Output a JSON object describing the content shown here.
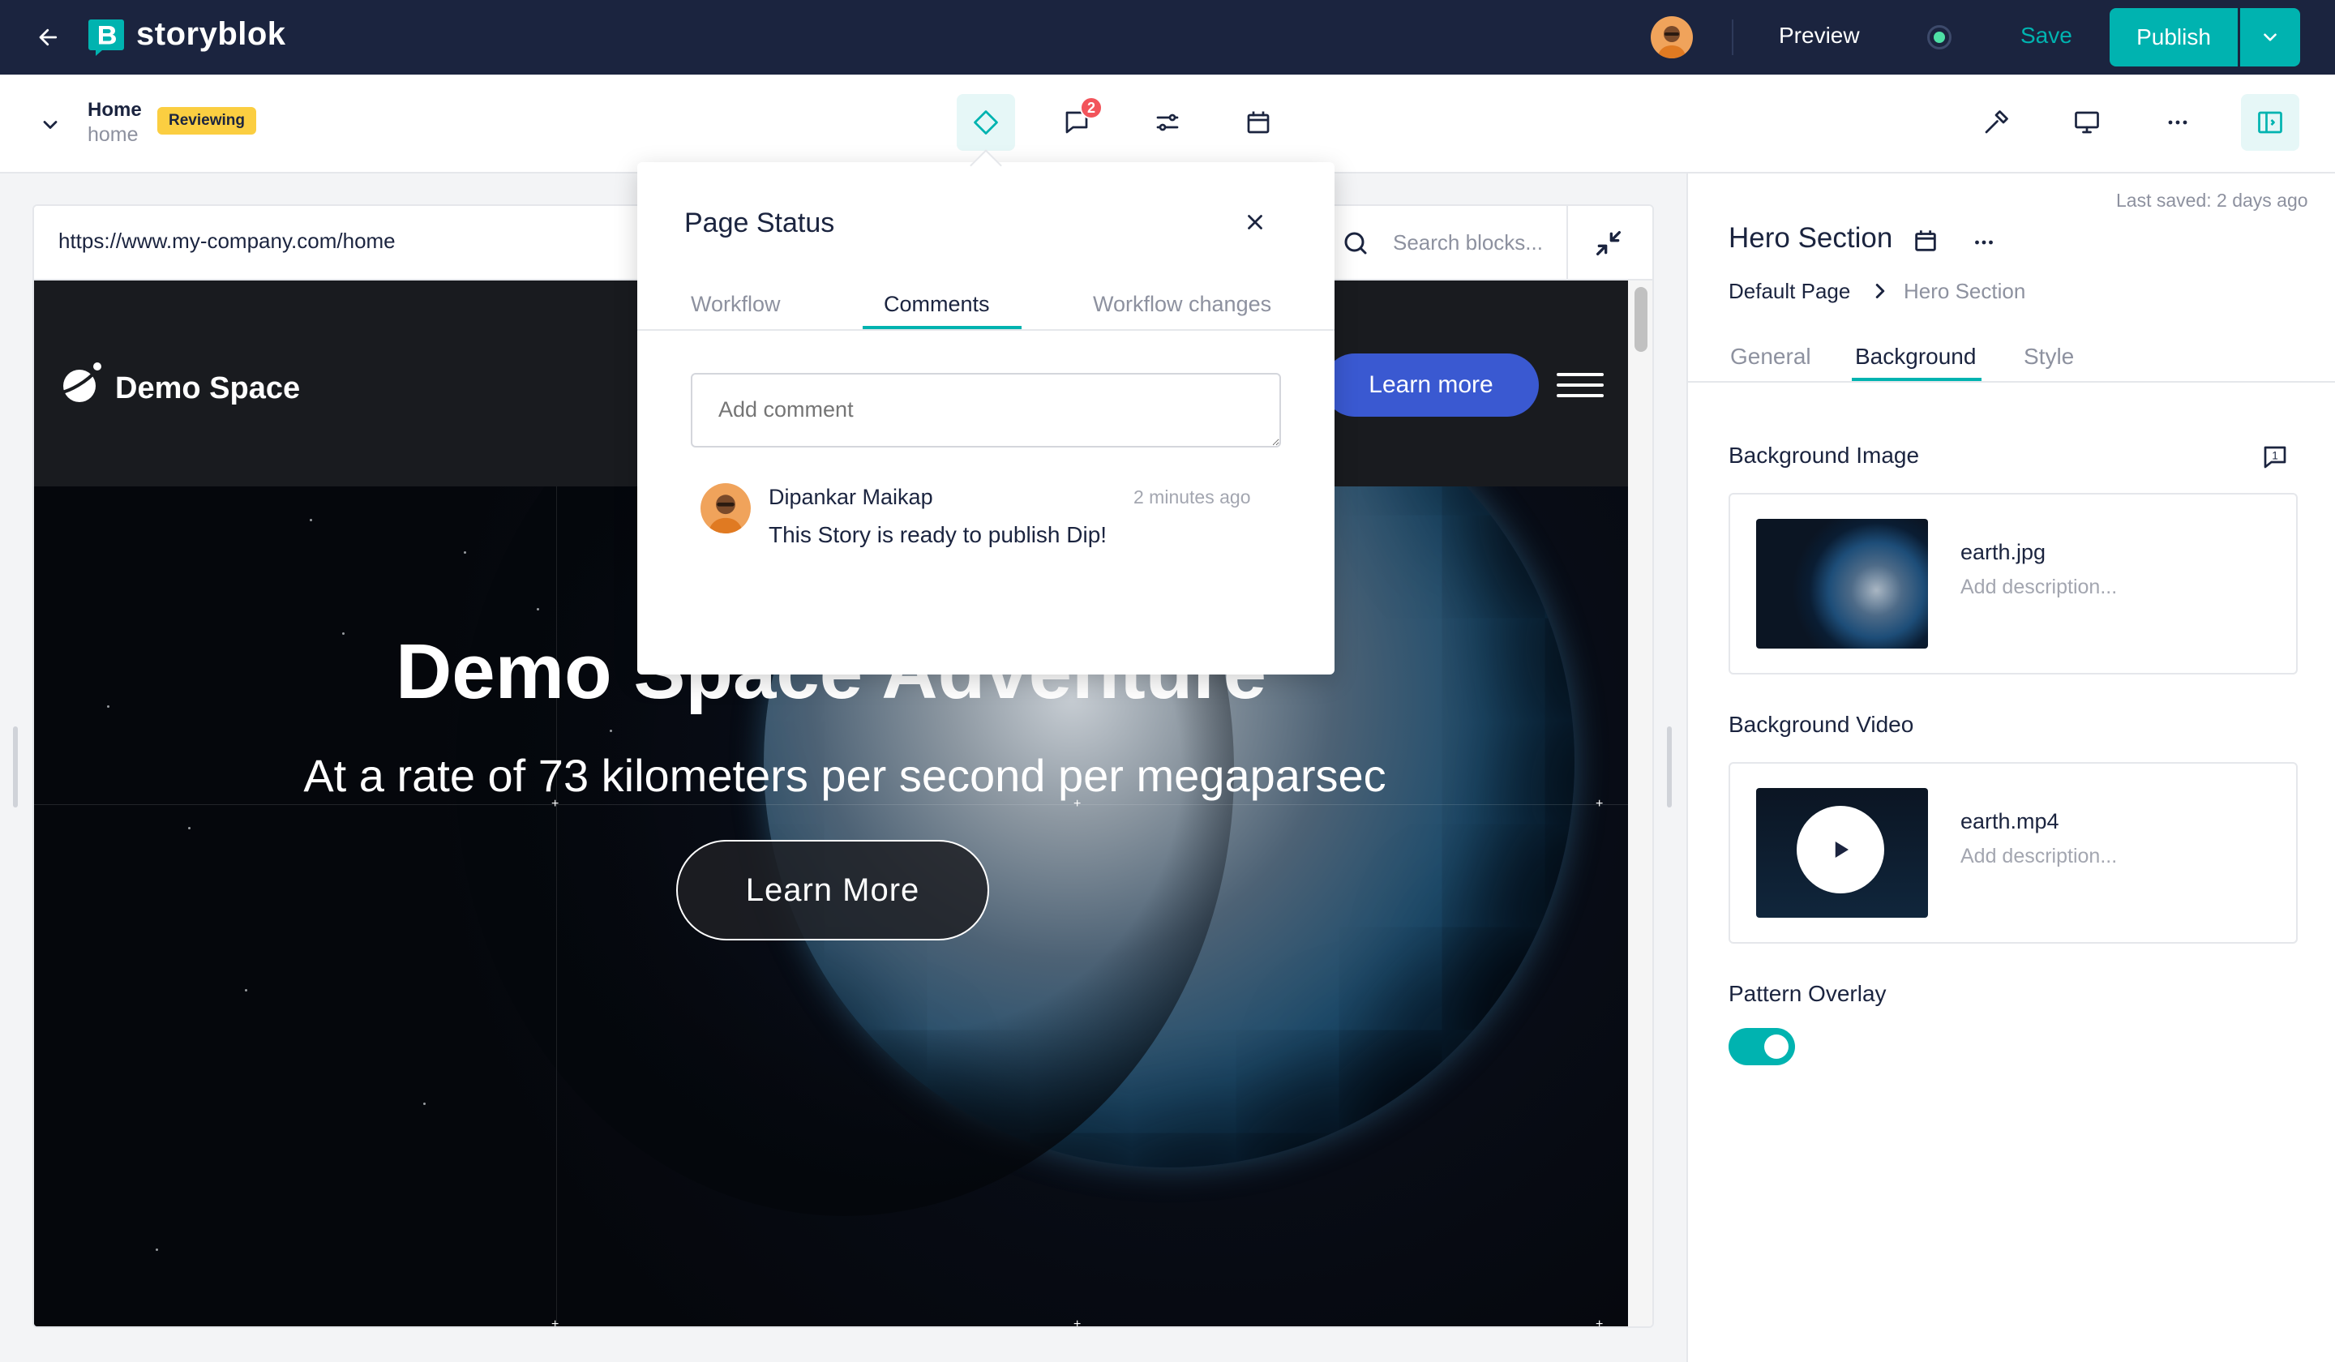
{
  "app": {
    "brand": "storyblok",
    "accent_color": "#00b3b0",
    "topbar_color": "#1b243f"
  },
  "topbar": {
    "preview_label": "Preview",
    "save_label": "Save",
    "publish_label": "Publish"
  },
  "story": {
    "name": "Home",
    "slug": "home",
    "status_badge": "Reviewing",
    "comment_count": "2"
  },
  "preview": {
    "url": "https://www.my-company.com/home",
    "search_placeholder": "Search blocks..."
  },
  "site": {
    "title": "Demo Space",
    "nav_cta": "Learn more",
    "hero_title": "Demo Space Adventure",
    "hero_subtitle": "At a rate of 73 kilometers per second per megaparsec",
    "hero_button": "Learn More"
  },
  "page_status": {
    "title": "Page Status",
    "tabs": [
      "Workflow",
      "Comments",
      "Workflow changes"
    ],
    "active_tab": "Comments",
    "comment_placeholder": "Add comment",
    "comments": [
      {
        "author": "Dipankar Maikap",
        "time": "2 minutes ago",
        "text": "This Story is ready to publish Dip!"
      }
    ]
  },
  "right_panel": {
    "last_saved": "Last saved: 2 days ago",
    "title": "Hero Section",
    "breadcrumb": [
      "Default Page",
      "Hero Section"
    ],
    "tabs": [
      "General",
      "Background",
      "Style"
    ],
    "active_tab": "Background",
    "background_image": {
      "label": "Background Image",
      "comment_count": "1",
      "file": "earth.jpg",
      "description_placeholder": "Add description..."
    },
    "background_video": {
      "label": "Background Video",
      "file": "earth.mp4",
      "description_placeholder": "Add description..."
    },
    "pattern_overlay": {
      "label": "Pattern Overlay",
      "enabled": true
    }
  }
}
